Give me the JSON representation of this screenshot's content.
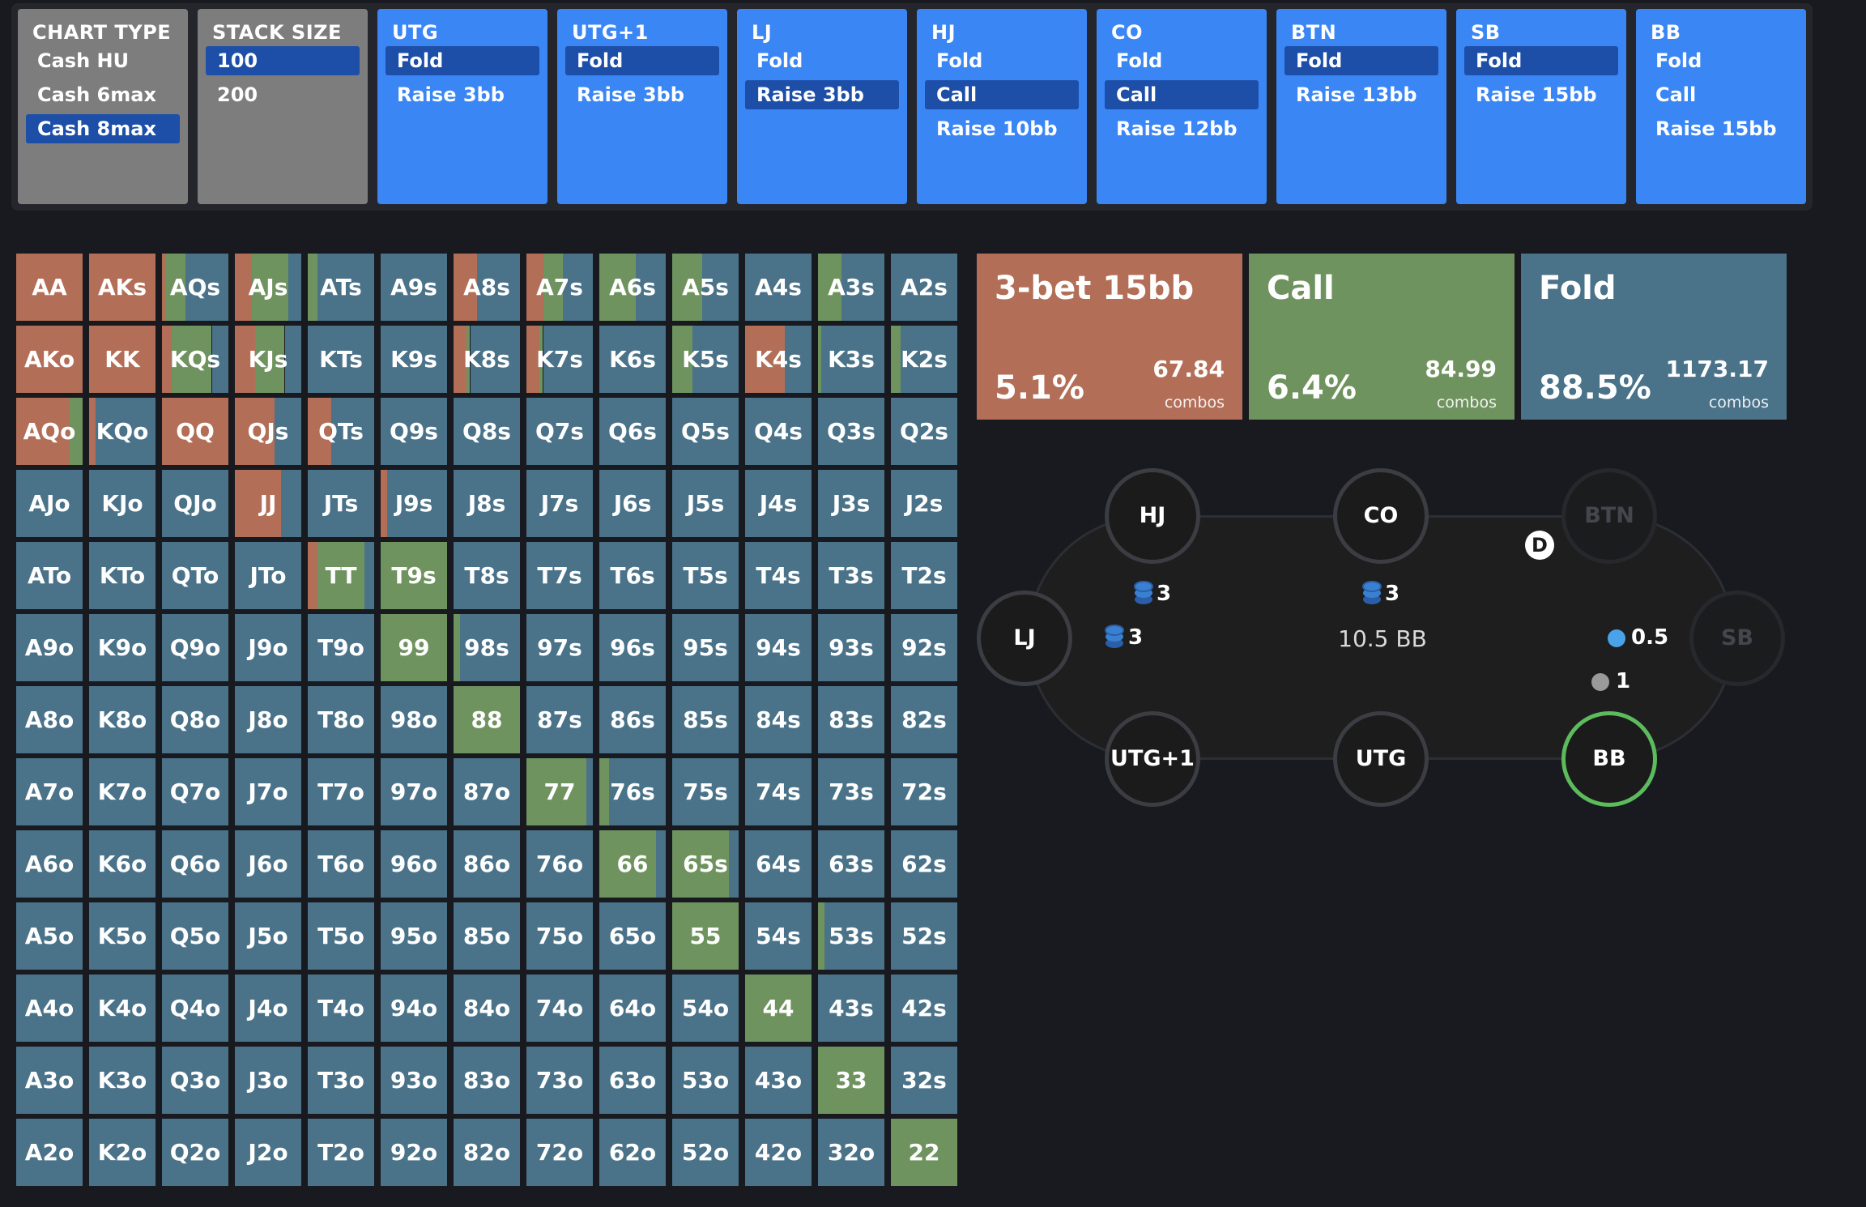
{
  "selectors": [
    {
      "title": "CHART TYPE",
      "options": [
        "Cash HU",
        "Cash 6max",
        "Cash 8max"
      ],
      "selected": 2,
      "style": "gray"
    },
    {
      "title": "STACK SIZE",
      "options": [
        "100",
        "200"
      ],
      "selected": 0,
      "style": "gray"
    },
    {
      "title": "UTG",
      "options": [
        "Fold",
        "Raise 3bb"
      ],
      "selected": 0,
      "style": "blue"
    },
    {
      "title": "UTG+1",
      "options": [
        "Fold",
        "Raise 3bb"
      ],
      "selected": 0,
      "style": "blue"
    },
    {
      "title": "LJ",
      "options": [
        "Fold",
        "Raise 3bb"
      ],
      "selected": 1,
      "style": "blue"
    },
    {
      "title": "HJ",
      "options": [
        "Fold",
        "Call",
        "Raise 10bb"
      ],
      "selected": 1,
      "style": "blue"
    },
    {
      "title": "CO",
      "options": [
        "Fold",
        "Call",
        "Raise 12bb"
      ],
      "selected": 1,
      "style": "blue"
    },
    {
      "title": "BTN",
      "options": [
        "Fold",
        "Raise 13bb"
      ],
      "selected": 0,
      "style": "blue"
    },
    {
      "title": "SB",
      "options": [
        "Fold",
        "Raise 15bb"
      ],
      "selected": 0,
      "style": "blue"
    },
    {
      "title": "BB",
      "options": [
        "Fold",
        "Call",
        "Raise 15bb"
      ],
      "selected": -1,
      "style": "blue"
    }
  ],
  "colors": {
    "raise": "#b36e57",
    "call": "#6f935f",
    "fold": "#4a7289",
    "panel_blue": "#3b86f5",
    "panel_selected": "#1d4fa8",
    "active_seat": "#5cbb5c",
    "chip_blue": "#3a80d0",
    "chip_sb": "#4aa3e8",
    "chip_bb": "#9a9a9a"
  },
  "hand_grid": {
    "rows": [
      [
        "AA",
        "AKs",
        "AQs",
        "AJs",
        "ATs",
        "A9s",
        "A8s",
        "A7s",
        "A6s",
        "A5s",
        "A4s",
        "A3s",
        "A2s"
      ],
      [
        "AKo",
        "KK",
        "KQs",
        "KJs",
        "KTs",
        "K9s",
        "K8s",
        "K7s",
        "K6s",
        "K5s",
        "K4s",
        "K3s",
        "K2s"
      ],
      [
        "AQo",
        "KQo",
        "QQ",
        "QJs",
        "QTs",
        "Q9s",
        "Q8s",
        "Q7s",
        "Q6s",
        "Q5s",
        "Q4s",
        "Q3s",
        "Q2s"
      ],
      [
        "AJo",
        "KJo",
        "QJo",
        "JJ",
        "JTs",
        "J9s",
        "J8s",
        "J7s",
        "J6s",
        "J5s",
        "J4s",
        "J3s",
        "J2s"
      ],
      [
        "ATo",
        "KTo",
        "QTo",
        "JTo",
        "TT",
        "T9s",
        "T8s",
        "T7s",
        "T6s",
        "T5s",
        "T4s",
        "T3s",
        "T2s"
      ],
      [
        "A9o",
        "K9o",
        "Q9o",
        "J9o",
        "T9o",
        "99",
        "98s",
        "97s",
        "96s",
        "95s",
        "94s",
        "93s",
        "92s"
      ],
      [
        "A8o",
        "K8o",
        "Q8o",
        "J8o",
        "T8o",
        "98o",
        "88",
        "87s",
        "86s",
        "85s",
        "84s",
        "83s",
        "82s"
      ],
      [
        "A7o",
        "K7o",
        "Q7o",
        "J7o",
        "T7o",
        "97o",
        "87o",
        "77",
        "76s",
        "75s",
        "74s",
        "73s",
        "72s"
      ],
      [
        "A6o",
        "K6o",
        "Q6o",
        "J6o",
        "T6o",
        "96o",
        "86o",
        "76o",
        "66",
        "65s",
        "64s",
        "63s",
        "62s"
      ],
      [
        "A5o",
        "K5o",
        "Q5o",
        "J5o",
        "T5o",
        "95o",
        "85o",
        "75o",
        "65o",
        "55",
        "54s",
        "53s",
        "52s"
      ],
      [
        "A4o",
        "K4o",
        "Q4o",
        "J4o",
        "T4o",
        "94o",
        "84o",
        "74o",
        "64o",
        "54o",
        "44",
        "43s",
        "42s"
      ],
      [
        "A3o",
        "K3o",
        "Q3o",
        "J3o",
        "T3o",
        "93o",
        "83o",
        "73o",
        "63o",
        "53o",
        "43o",
        "33",
        "32s"
      ],
      [
        "A2o",
        "K2o",
        "Q2o",
        "J2o",
        "T2o",
        "92o",
        "82o",
        "72o",
        "62o",
        "52o",
        "42o",
        "32o",
        "22"
      ]
    ],
    "mix": {
      "AA": [
        1,
        0,
        0
      ],
      "AKs": [
        1,
        0,
        0
      ],
      "AQs": [
        0.05,
        0.3,
        0.65
      ],
      "AJs": [
        0.25,
        0.55,
        0.2
      ],
      "ATs": [
        0,
        0.15,
        0.85
      ],
      "A9s": [
        0,
        0,
        1
      ],
      "A8s": [
        0.35,
        0,
        0.65
      ],
      "A7s": [
        0.25,
        0.3,
        0.45
      ],
      "A6s": [
        0,
        0.55,
        0.45
      ],
      "A5s": [
        0,
        0.45,
        0.55
      ],
      "A4s": [
        0,
        0,
        1
      ],
      "A3s": [
        0,
        0.35,
        0.65
      ],
      "A2s": [
        0,
        0,
        1
      ],
      "AKo": [
        1,
        0,
        0
      ],
      "KK": [
        1,
        0,
        0
      ],
      "KQs": [
        0.15,
        0.6,
        0.25
      ],
      "KJs": [
        0.3,
        0.45,
        0.25
      ],
      "KTs": [
        0,
        0,
        1
      ],
      "K9s": [
        0,
        0,
        1
      ],
      "K8s": [
        0.2,
        0.05,
        0.75
      ],
      "K7s": [
        0.2,
        0.05,
        0.75
      ],
      "K6s": [
        0,
        0,
        1
      ],
      "K5s": [
        0,
        0.3,
        0.7
      ],
      "K4s": [
        0.6,
        0,
        0.4
      ],
      "K3s": [
        0,
        0.05,
        0.95
      ],
      "K2s": [
        0,
        0.15,
        0.85
      ],
      "AQo": [
        0.8,
        0.2,
        0
      ],
      "KQo": [
        0.1,
        0,
        0.9
      ],
      "QQ": [
        1,
        0,
        0
      ],
      "QJs": [
        0.6,
        0,
        0.4
      ],
      "QTs": [
        0.35,
        0,
        0.65
      ],
      "JJ": [
        0.7,
        0,
        0.3
      ],
      "J9s": [
        0.1,
        0,
        0.9
      ],
      "TT": [
        0.15,
        0.7,
        0.15
      ],
      "T9s": [
        0,
        1,
        0
      ],
      "99": [
        0,
        1,
        0
      ],
      "98s": [
        0,
        0.1,
        0.9
      ],
      "88": [
        0,
        1,
        0
      ],
      "77": [
        0,
        0.9,
        0.1
      ],
      "76s": [
        0,
        0.15,
        0.85
      ],
      "66": [
        0,
        0.85,
        0.15
      ],
      "65s": [
        0,
        0.85,
        0.15
      ],
      "55": [
        0,
        1,
        0
      ],
      "53s": [
        0,
        0.1,
        0.9
      ],
      "44": [
        0,
        1,
        0
      ],
      "33": [
        0,
        1,
        0
      ],
      "22": [
        0,
        1,
        0
      ]
    }
  },
  "stats": [
    {
      "name": "3-bet 15bb",
      "pct": "5.1%",
      "combos": "67.84",
      "unit": "combos",
      "type": "raise"
    },
    {
      "name": "Call",
      "pct": "6.4%",
      "combos": "84.99",
      "unit": "combos",
      "type": "call"
    },
    {
      "name": "Fold",
      "pct": "88.5%",
      "combos": "1173.17",
      "unit": "combos",
      "type": "fold"
    }
  ],
  "table": {
    "seats": [
      {
        "label": "HJ",
        "state": "normal"
      },
      {
        "label": "CO",
        "state": "normal"
      },
      {
        "label": "BTN",
        "state": "folded"
      },
      {
        "label": "LJ",
        "state": "normal"
      },
      {
        "label": "SB",
        "state": "folded"
      },
      {
        "label": "UTG+1",
        "state": "normal"
      },
      {
        "label": "UTG",
        "state": "normal"
      },
      {
        "label": "BB",
        "state": "active"
      }
    ],
    "bets": {
      "hj": "3",
      "co": "3",
      "lj": "3",
      "sb": "0.5",
      "bb": "1"
    },
    "pot": "10.5 BB",
    "dealer": "D"
  }
}
